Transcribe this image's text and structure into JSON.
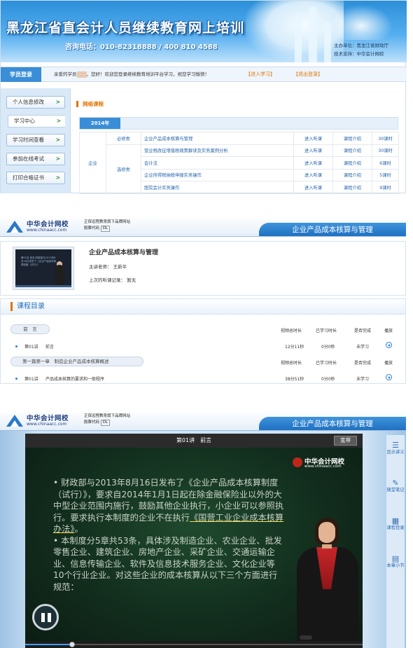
{
  "panel1": {
    "banner": {
      "title": "黑龙江省直会计人员继续教育网上培训",
      "phone": "咨询电话：010-82318888 / 400 810 4588",
      "host": "主办单位：黑龙江省财政厅",
      "tech": "技术支持：中华会计网校"
    },
    "loginbar": {
      "tab": "学员登录",
      "welcome_pre": "亲爱的学员",
      "welcome_post": "，您好！欢迎您登录继续教育培训平台学习，祝您学习愉快！",
      "enter": "【进入学习】",
      "exit": "【退出登录】"
    },
    "side_menu": [
      {
        "label": "个人信息修改",
        "arrow": ">"
      },
      {
        "label": "学习中心",
        "arrow": ">"
      },
      {
        "label": "学习时间查看",
        "arrow": ">"
      },
      {
        "label": "参加在线考试",
        "arrow": ">"
      },
      {
        "label": "打印合格证书",
        "arrow": ">"
      }
    ],
    "section_title": "网络课程",
    "year": "2014年",
    "category": "企业",
    "required": "必修类",
    "elective": "选修类",
    "courses": [
      {
        "name": "企业产品成本核算与管理",
        "listen": "进入听课",
        "intro": "课程介绍",
        "hours": "30课时"
      },
      {
        "name": "营业税改征增值税政策解读及实务案例分析",
        "listen": "进入听课",
        "intro": "课程介绍",
        "hours": "30课时"
      },
      {
        "name": "会计法",
        "listen": "进入听课",
        "intro": "课程介绍",
        "hours": "6课时"
      },
      {
        "name": "企业所得税纳税申报实务操作",
        "listen": "进入听课",
        "intro": "课程介绍",
        "hours": "5课时"
      },
      {
        "name": "医院会计实务操作",
        "listen": "进入听课",
        "intro": "课程介绍",
        "hours": "9课时"
      }
    ]
  },
  "header": {
    "logo_name": "中华会计网校",
    "logo_url": "www.chinaacc.com",
    "slogan1": "正保远程教育旗下品牌网站",
    "slogan2_pre": "股票代码",
    "stock": "DL",
    "course_title": "企业产品成本核算与管理"
  },
  "panel2": {
    "thumb_text": "第01讲 前言  财政部与2013年8月16日发布了《企业产品成本核算制度（试行）》",
    "course_name": "企业产品成本核算与管理",
    "teacher": "主讲老师：  王新平",
    "last_record": "上次的听课记录：  暂无",
    "catalog_title": "课程目录",
    "col_duration": "视频总时长",
    "col_learned": "已学习时长",
    "col_done": "是否完成",
    "col_play": "播放",
    "chapters": [
      {
        "title": "前　言",
        "lessons": [
          {
            "no": "第01讲",
            "name": "前言",
            "duration": "12分11秒",
            "learned": "0分0秒",
            "status": "未学习"
          }
        ]
      },
      {
        "title": "第一篇第一章　制造企业产品成本核算概述",
        "lessons": [
          {
            "no": "第01讲",
            "name": "产品成本核算的要求和一般程序",
            "duration": "38分51秒",
            "learned": "0分0秒",
            "status": "未学习"
          }
        ]
      }
    ]
  },
  "panel3": {
    "lesson_title": "第01讲　前言",
    "wide_button": "宽带",
    "video_logo_name": "中华会计网校",
    "video_logo_url": "www.chinaacc.com",
    "slide_p1": "• 财政部与2013年8月16日发布了《企业产品成本核算制度（试行）》，要求自2014年1月1日起在除金融保险业以外的大中型企业范围内施行，鼓励其他企业执行，小企业可以参照执行。要求执行本制度的企业不在执行",
    "slide_p1_u": "《国营工业企业成本核算办法》",
    "slide_p1_end": "。",
    "slide_p2": "• 本制度分5章共53条，具体涉及制造企业、农业企业、批发零售企业、建筑企业、房地产企业、采矿企业、交通运输企业、信息传输企业、软件及信息技术服务企业、文化企业等10个行业企业。对这些企业的成本核算从以下三个方面进行规范：",
    "playback_progress": 0.14,
    "tools": [
      {
        "icon": "☰",
        "label": "显示讲义"
      },
      {
        "icon": "✎",
        "label": "随堂笔记"
      },
      {
        "icon": "▦",
        "label": "课程目录"
      },
      {
        "icon": "▤",
        "label": "本章小节"
      }
    ]
  }
}
